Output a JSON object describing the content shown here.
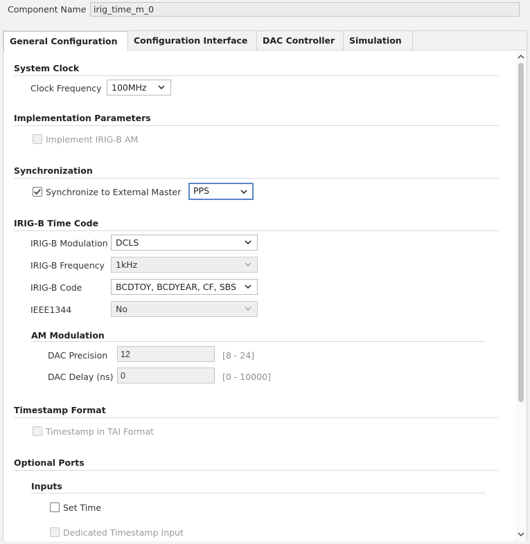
{
  "component": {
    "label": "Component Name",
    "value": "irig_time_m_0"
  },
  "tabs": [
    {
      "label": "General Configuration",
      "active": true
    },
    {
      "label": "Configuration Interface",
      "active": false
    },
    {
      "label": "DAC Controller",
      "active": false
    },
    {
      "label": "Simulation",
      "active": false
    }
  ],
  "system_clock": {
    "title": "System Clock",
    "clock_frequency": {
      "label": "Clock Frequency",
      "value": "100MHz"
    }
  },
  "implementation": {
    "title": "Implementation Parameters",
    "implement_irig_am": {
      "label": "Implement IRIG-B AM",
      "checked": false,
      "enabled": false
    }
  },
  "synchronization": {
    "title": "Synchronization",
    "sync_external": {
      "label": "Synchronize to External Master",
      "checked": true
    },
    "sync_source": {
      "value": "PPS"
    }
  },
  "irig_time_code": {
    "title": "IRIG-B Time Code",
    "modulation": {
      "label": "IRIG-B Modulation",
      "value": "DCLS"
    },
    "frequency": {
      "label": "IRIG-B Frequency",
      "value": "1kHz"
    },
    "code": {
      "label": "IRIG-B Code",
      "value": "BCDTOY, BCDYEAR, CF, SBS"
    },
    "ieee1344": {
      "label": "IEEE1344",
      "value": "No"
    },
    "am_modulation": {
      "title": "AM Modulation",
      "dac_precision": {
        "label": "DAC Precision",
        "value": "12",
        "range": "[8 - 24]"
      },
      "dac_delay": {
        "label": "DAC Delay (ns)",
        "value": "0",
        "range": "[0 - 10000]"
      }
    }
  },
  "timestamp_format": {
    "title": "Timestamp Format",
    "tai_format": {
      "label": "Timestamp in TAI Format",
      "checked": false,
      "enabled": false
    }
  },
  "optional_ports": {
    "title": "Optional Ports",
    "inputs": {
      "title": "Inputs",
      "set_time": {
        "label": "Set Time",
        "checked": false
      },
      "dedicated_timestamp": {
        "label": "Dedicated Timestamp Input",
        "checked": false,
        "enabled": false
      }
    }
  },
  "icons": {
    "dropdown": "chevron-down-icon",
    "check": "check-icon",
    "scroll_up": "scroll-up-arrow-icon",
    "scroll_down": "scroll-down-arrow-icon"
  },
  "colors": {
    "focus_border": "#5a86c8",
    "disabled_text": "#9a9a9a",
    "hint_text": "#8c8c8c"
  }
}
